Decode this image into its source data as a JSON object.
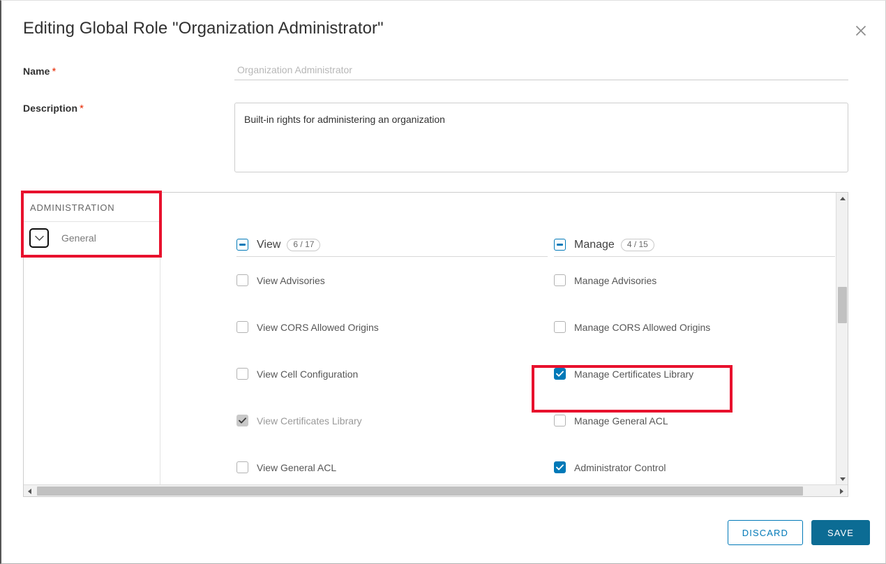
{
  "dialog": {
    "title": "Editing Global Role \"Organization Administrator\"",
    "close_icon": "close-icon"
  },
  "form": {
    "name": {
      "label": "Name",
      "required_marker": "*",
      "value": "",
      "placeholder": "Organization Administrator"
    },
    "description": {
      "label": "Description",
      "required_marker": "*",
      "value": "Built-in rights for administering an organization",
      "placeholder": ""
    }
  },
  "rights_panel": {
    "sidebar": {
      "group_label": "ADMINISTRATION",
      "items": [
        {
          "label": "General",
          "expand_icon": "chevron-down-icon",
          "expanded": false
        }
      ]
    },
    "columns": [
      {
        "key": "view",
        "label": "View",
        "count_badge": "6 / 17",
        "header_state": "indeterminate",
        "rights": [
          {
            "label": "View Advisories",
            "checked": false,
            "disabled": false
          },
          {
            "label": "View CORS Allowed Origins",
            "checked": false,
            "disabled": false
          },
          {
            "label": "View Cell Configuration",
            "checked": false,
            "disabled": false
          },
          {
            "label": "View Certificates Library",
            "checked": true,
            "disabled": true
          },
          {
            "label": "View General ACL",
            "checked": false,
            "disabled": false
          }
        ]
      },
      {
        "key": "manage",
        "label": "Manage",
        "count_badge": "4 / 15",
        "header_state": "indeterminate",
        "rights": [
          {
            "label": "Manage Advisories",
            "checked": false,
            "disabled": false
          },
          {
            "label": "Manage CORS Allowed Origins",
            "checked": false,
            "disabled": false
          },
          {
            "label": "Manage Certificates Library",
            "checked": true,
            "disabled": false
          },
          {
            "label": "Manage General ACL",
            "checked": false,
            "disabled": false
          },
          {
            "label": "Administrator Control",
            "checked": true,
            "disabled": false
          }
        ]
      }
    ],
    "scrollbars": {
      "vertical_up_icon": "arrow-up-icon",
      "vertical_down_icon": "arrow-down-icon",
      "horizontal_left_icon": "arrow-left-icon",
      "horizontal_right_icon": "arrow-right-icon"
    }
  },
  "footer": {
    "discard_label": "DISCARD",
    "save_label": "SAVE"
  },
  "colors": {
    "accent": "#0079b8",
    "save_button": "#0c6c94",
    "required": "#e62700",
    "annotation": "#e8112d"
  }
}
